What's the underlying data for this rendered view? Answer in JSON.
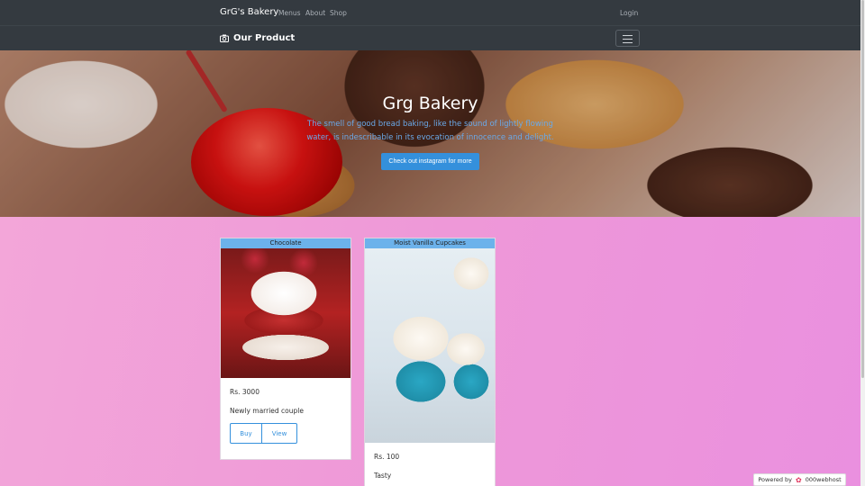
{
  "nav": {
    "brand": "GrG's Bakery",
    "links": [
      "Menus",
      "About",
      "Shop"
    ],
    "login": "Login"
  },
  "subnav": {
    "title": "Our Product",
    "icon": "camera-icon"
  },
  "hero": {
    "title": "Grg Bakery",
    "text": "The smell of good bread baking, like the sound of lightly flowing water, is indescribable in its evocation of innocence and delight.",
    "button": "Check out instagram for more"
  },
  "products": [
    {
      "name": "Chocolate",
      "price": "Rs. 3000",
      "desc": "Newly married couple",
      "buy": "Buy",
      "view": "View"
    },
    {
      "name": "Moist Vanilla Cupcakes",
      "price": "Rs. 100",
      "desc": "Tasty"
    }
  ],
  "footer": {
    "powered_by": "Powered by",
    "host": "000webhost"
  },
  "colors": {
    "navbar": "#343a40",
    "accent": "#3490dc",
    "card_header": "#6cb2eb",
    "page_bg": "#ee9bd8"
  }
}
